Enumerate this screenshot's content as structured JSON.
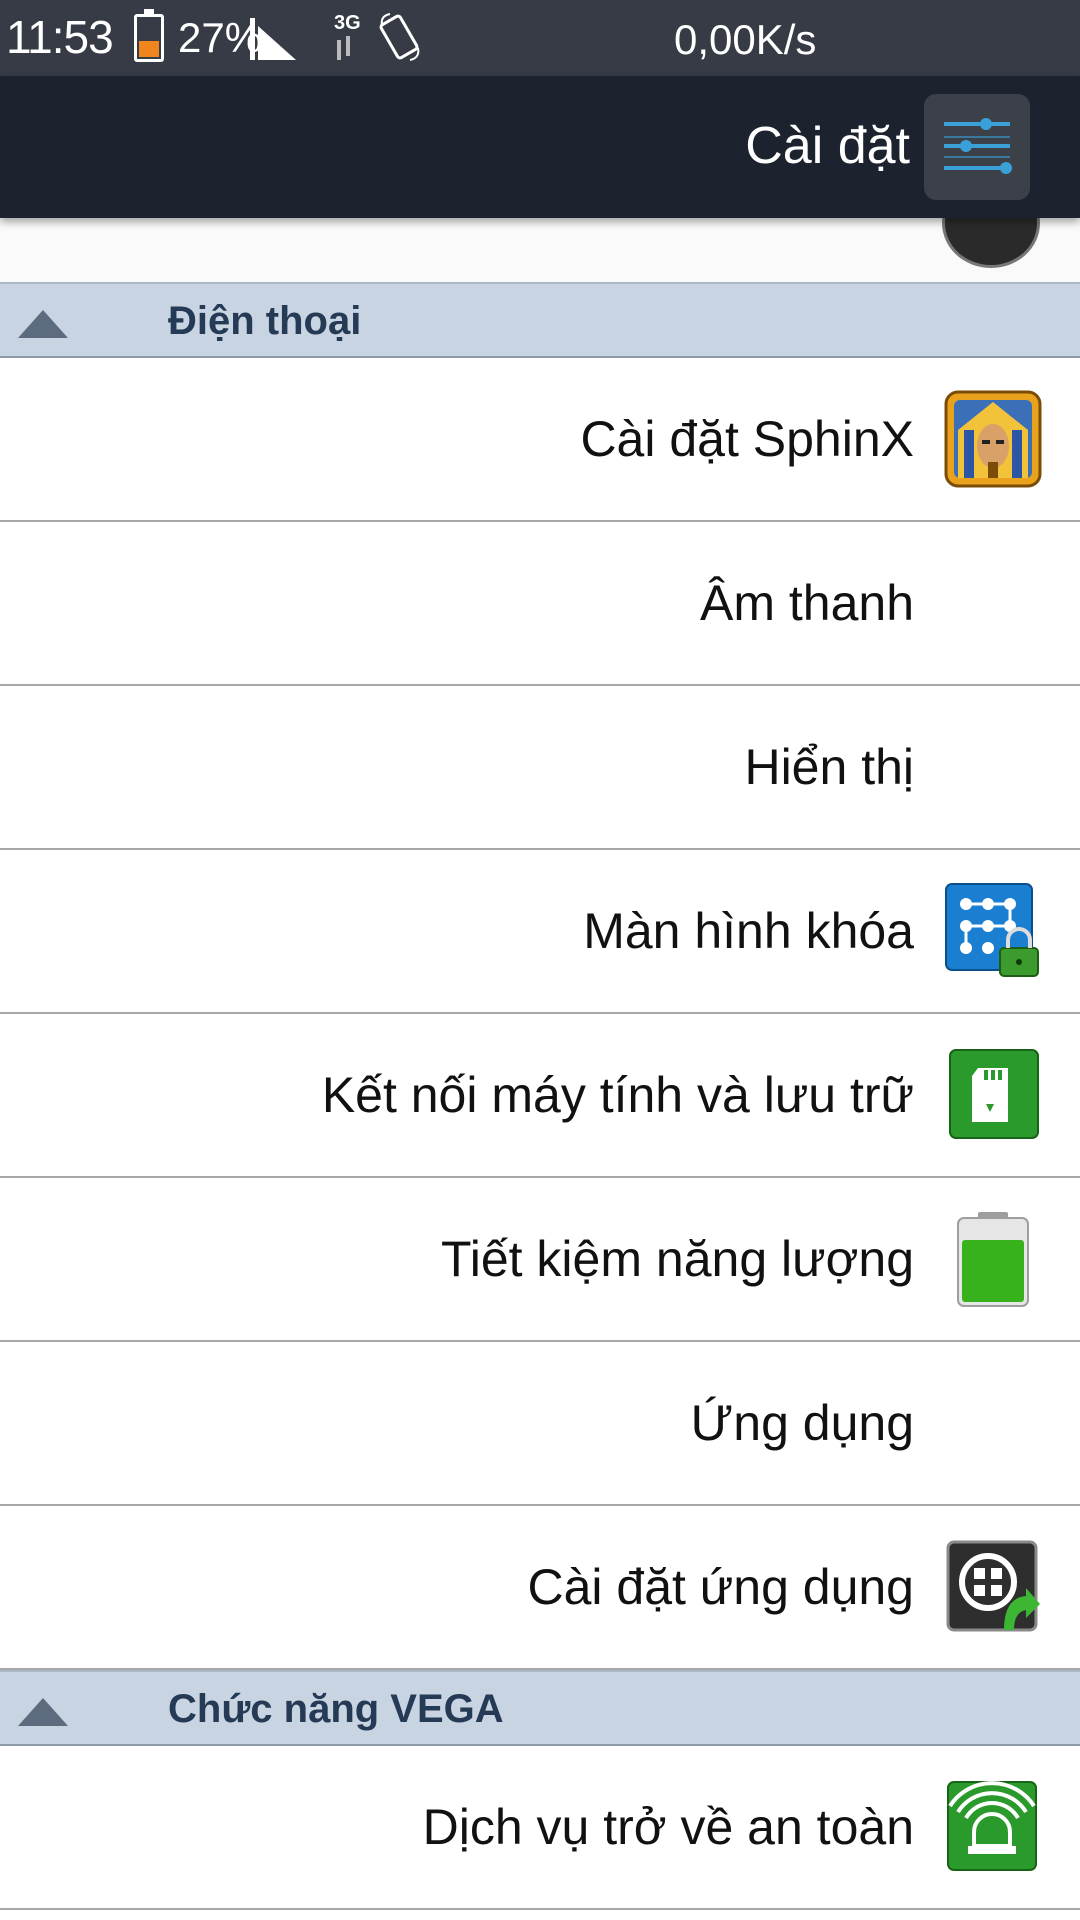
{
  "status_bar": {
    "time": "11:53",
    "battery_percent": "27%",
    "network_type": "3G",
    "net_speed": "0,00K/s"
  },
  "app_bar": {
    "title": "Cài đặt",
    "menu_icon": "settings-sliders-icon"
  },
  "sections": [
    {
      "label": "Điện thoại",
      "items": [
        {
          "label": "Cài đặt SphinX",
          "icon": "sphinx-icon"
        },
        {
          "label": "Âm thanh",
          "icon": null
        },
        {
          "label": "Hiển thị",
          "icon": null
        },
        {
          "label": "Màn hình khóa",
          "icon": "lock-screen-pattern-icon"
        },
        {
          "label": "Kết nối máy tính và lưu trữ",
          "icon": "sd-card-icon"
        },
        {
          "label": "Tiết kiệm năng lượng",
          "icon": "battery-icon"
        },
        {
          "label": "Ứng dụng",
          "icon": null
        },
        {
          "label": "Cài đặt ứng dụng",
          "icon": "app-install-icon"
        }
      ]
    },
    {
      "label": "Chức năng VEGA",
      "items": [
        {
          "label": "Dịch vụ trở về an toàn",
          "icon": "safety-alarm-icon"
        }
      ]
    }
  ],
  "colors": {
    "status_bar_bg": "#363b45",
    "app_bar_bg": "#1c232e",
    "section_header_bg": "#c8d4e2",
    "section_header_text": "#253a55",
    "accent_blue": "#3aa0d8"
  }
}
